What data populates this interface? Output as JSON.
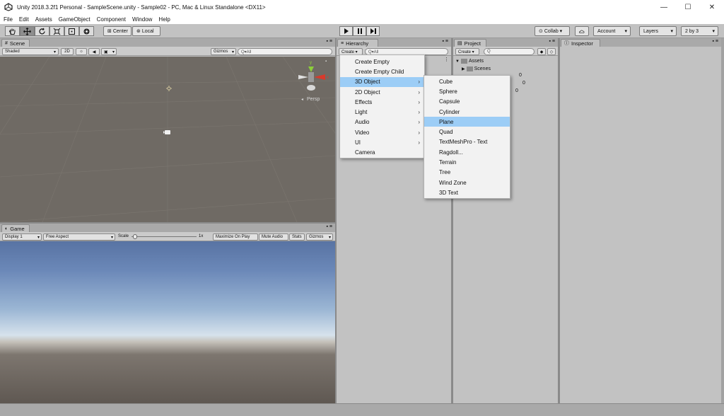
{
  "window": {
    "title": "Unity 2018.3.2f1 Personal - SampleScene.unity - Sample02 - PC, Mac & Linux Standalone <DX11>"
  },
  "menubar": [
    "File",
    "Edit",
    "Assets",
    "GameObject",
    "Component",
    "Window",
    "Help"
  ],
  "toolbar": {
    "center_label": "Center",
    "local_label": "Local",
    "collab_label": "Collab ▾",
    "account_label": "Account",
    "layers_label": "Layers",
    "layout_label": "2 by 3"
  },
  "scene": {
    "tab_label": "Scene",
    "shading_label": "Shaded",
    "mode_label": "2D",
    "gizmos_label": "Gizmos",
    "search_placeholder": "Q▾All",
    "persp_label": "Persp",
    "gizmo_axes": {
      "y": "y",
      "x": "x"
    }
  },
  "game": {
    "tab_label": "Game",
    "display_label": "Display 1",
    "aspect_label": "Free Aspect",
    "scale_label": "Scale",
    "scale_value": "1x",
    "maximize_label": "Maximize On Play",
    "mute_label": "Mute Audio",
    "stats_label": "Stats",
    "gizmos_label": "Gizmos"
  },
  "hierarchy": {
    "tab_label": "Hierarchy",
    "create_label": "Create ▾",
    "search_placeholder": "Q▾All"
  },
  "project": {
    "tab_label": "Project",
    "create_label": "Create ▾",
    "search_placeholder": "Q",
    "tree": [
      {
        "label": "Assets",
        "level": 0
      },
      {
        "label": "Scenes",
        "level": 1
      }
    ],
    "partial_labels": [
      "0",
      "0",
      "0"
    ]
  },
  "inspector": {
    "tab_label": "Inspector"
  },
  "create_menu": [
    {
      "label": "Create Empty",
      "submenu": false
    },
    {
      "label": "Create Empty Child",
      "submenu": false
    },
    {
      "label": "3D Object",
      "submenu": true,
      "selected": true
    },
    {
      "label": "2D Object",
      "submenu": true
    },
    {
      "label": "Effects",
      "submenu": true
    },
    {
      "label": "Light",
      "submenu": true
    },
    {
      "label": "Audio",
      "submenu": true
    },
    {
      "label": "Video",
      "submenu": true
    },
    {
      "label": "UI",
      "submenu": true
    },
    {
      "label": "Camera",
      "submenu": false
    }
  ],
  "submenu_3d": [
    {
      "label": "Cube"
    },
    {
      "label": "Sphere"
    },
    {
      "label": "Capsule"
    },
    {
      "label": "Cylinder"
    },
    {
      "label": "Plane",
      "selected": true
    },
    {
      "label": "Quad"
    },
    {
      "label": "TextMeshPro - Text"
    },
    {
      "label": "Ragdoll..."
    },
    {
      "label": "Terrain"
    },
    {
      "label": "Tree"
    },
    {
      "label": "Wind Zone"
    },
    {
      "label": "3D Text"
    }
  ],
  "colors": {
    "scene_bg": "#6f6a64",
    "menu_highlight": "#9ccdf6",
    "panel_bg": "#c2c2c2",
    "gizmo_y": "#8ccf3a",
    "gizmo_x": "#d73a2c"
  }
}
